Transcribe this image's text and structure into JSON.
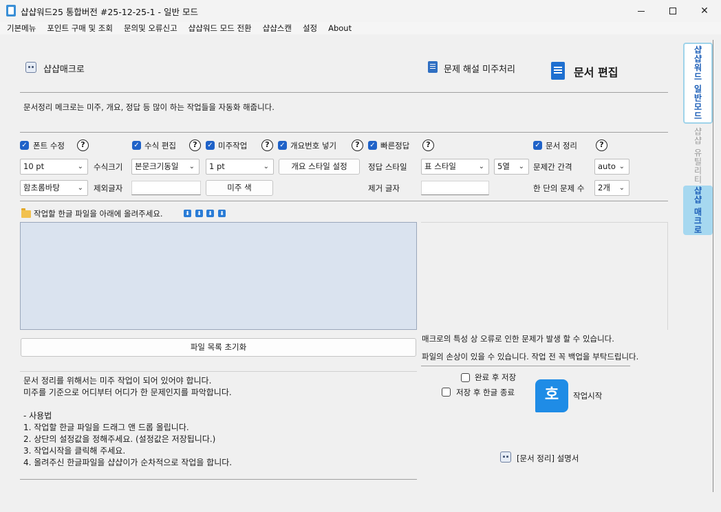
{
  "window": {
    "title": "샵샵워드25 통합버전 #25-12-25-1 - 일반 모드",
    "minimize": "—",
    "close": "✕"
  },
  "menu": [
    "기본메뉴",
    "포인트 구매 및 조회",
    "문의및 오류신고",
    "샵샵워드 모드 전환",
    "샵샵스캔",
    "설정",
    "About"
  ],
  "header": {
    "macro_link": "샵샵매크로",
    "explain_link": "문제 해설 미주처리",
    "page_title": "문서 편집"
  },
  "description": "문서정리 메크로는 미주, 개요, 정답 등 많이 하는 작업들을 자동화 해줍니다.",
  "options": {
    "font_fix": "폰트 수정",
    "formula_edit": "수식 편집",
    "endnote_work": "미주작업",
    "outline_number": "개요번호 넣기",
    "quick_answer": "빠른정답",
    "doc_cleanup": "문서 정리",
    "help": "?"
  },
  "row1": {
    "font_size": "10 pt",
    "formula_size_label": "수식크기",
    "formula_size": "본문크기동일",
    "line_width": "1 pt",
    "outline_style_button": "개요 스타일 설정",
    "answer_style_label": "정답 스타일",
    "answer_style": "표 스타일",
    "columns": "5열",
    "spacing_label": "문제간 간격",
    "spacing": "auto"
  },
  "row2": {
    "font_name": "함초롬바탕",
    "exclude_label": "제외글자",
    "exclude_value": "",
    "endnote_color_button": "미주 색",
    "remove_label": "제거 글자",
    "remove_value": "",
    "per_column_label": "한 단의 문제 수",
    "per_column": "2개"
  },
  "upload_prompt": "작업할 한글 파일을 아래에 올려주세요.",
  "arrow_glyph": "⬇",
  "reset_button": "파일 목록 초기화",
  "warning_1": "매크로의 특성 상 오류로 인한 문제가 발생 할 수 있습니다.",
  "warning_2": "파일의 손상이 있을 수 있습니다. 작업 전 꼭 백업을 부탁드립니다.",
  "instructions": "문서 정리를 위해서는 미주 작업이 되어 있어야 합니다.\n미주를 기준으로 어디부터 어디가 한 문제인지를 파악합니다.\n\n- 사용법\n1. 작업할 한글 파일을 드래그 앤 드롭 올립니다.\n2. 상단의 설정값을 정해주세요. (설정값은 저장됩니다.)\n3. 작업시작을 클릭해 주세요.\n4. 올려주신 한글파일을 샵샵이가 순차적으로 작업을 합니다.",
  "save_after": "완료 후 저장",
  "close_after": "저장 후 한글 종료",
  "hwp_glyph": "호",
  "start_label": "작업시작",
  "manual_link": "[문서 정리] 설명서",
  "side_tabs": [
    "샵샵워드 일반모드",
    "샵샵 유틸리티",
    "샵샵 매크로"
  ],
  "chevron": "⌄"
}
